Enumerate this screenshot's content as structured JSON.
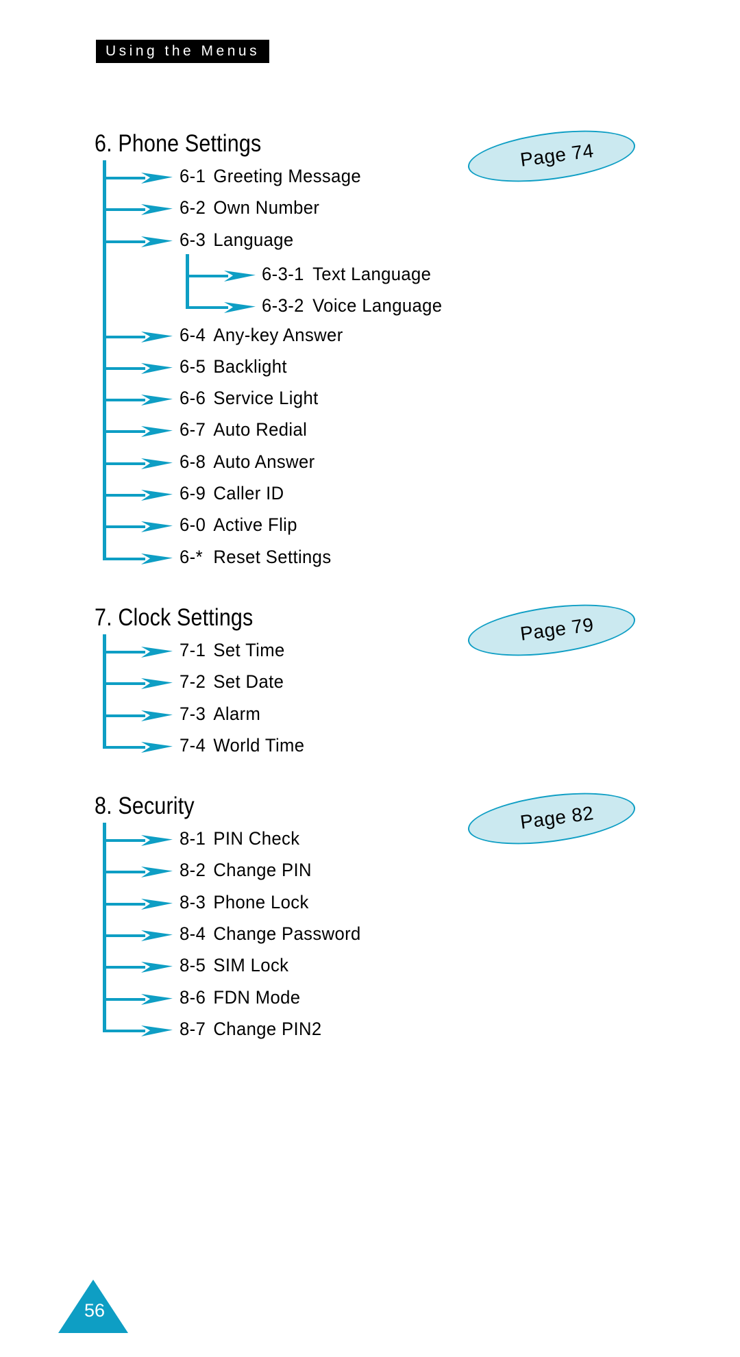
{
  "header": {
    "running_title": "Using the Menus"
  },
  "footer": {
    "page_number": "56"
  },
  "sections": [
    {
      "heading": "6. Phone Settings",
      "badge": "Page 74",
      "items": [
        {
          "num": "6-1",
          "label": "Greeting Message"
        },
        {
          "num": "6-2",
          "label": "Own Number"
        },
        {
          "num": "6-3",
          "label": "Language"
        },
        {
          "num": "6-4",
          "label": "Any-key Answer"
        },
        {
          "num": "6-5",
          "label": "Backlight"
        },
        {
          "num": "6-6",
          "label": "Service Light"
        },
        {
          "num": "6-7",
          "label": "Auto Redial"
        },
        {
          "num": "6-8",
          "label": "Auto Answer"
        },
        {
          "num": "6-9",
          "label": "Caller ID"
        },
        {
          "num": "6-0",
          "label": "Active Flip"
        },
        {
          "num": "6-*",
          "label": "Reset Settings"
        }
      ],
      "subitems": [
        {
          "num": "6-3-1",
          "label": "Text Language"
        },
        {
          "num": "6-3-2",
          "label": "Voice Language"
        }
      ]
    },
    {
      "heading": "7. Clock Settings",
      "badge": "Page 79",
      "items": [
        {
          "num": "7-1",
          "label": "Set Time"
        },
        {
          "num": "7-2",
          "label": "Set Date"
        },
        {
          "num": "7-3",
          "label": "Alarm"
        },
        {
          "num": "7-4",
          "label": "World Time"
        }
      ],
      "subitems": []
    },
    {
      "heading": "8. Security",
      "badge": "Page 82",
      "items": [
        {
          "num": "8-1",
          "label": "PIN Check"
        },
        {
          "num": "8-2",
          "label": "Change PIN"
        },
        {
          "num": "8-3",
          "label": "Phone Lock"
        },
        {
          "num": "8-4",
          "label": "Change Password"
        },
        {
          "num": "8-5",
          "label": "SIM Lock"
        },
        {
          "num": "8-6",
          "label": "FDN Mode"
        },
        {
          "num": "8-7",
          "label": "Change PIN2"
        }
      ],
      "subitems": []
    }
  ],
  "colors": {
    "accent_teal": "#0e9ec4",
    "badge_fill": "#cbe9f0",
    "header_band": "#000000"
  }
}
